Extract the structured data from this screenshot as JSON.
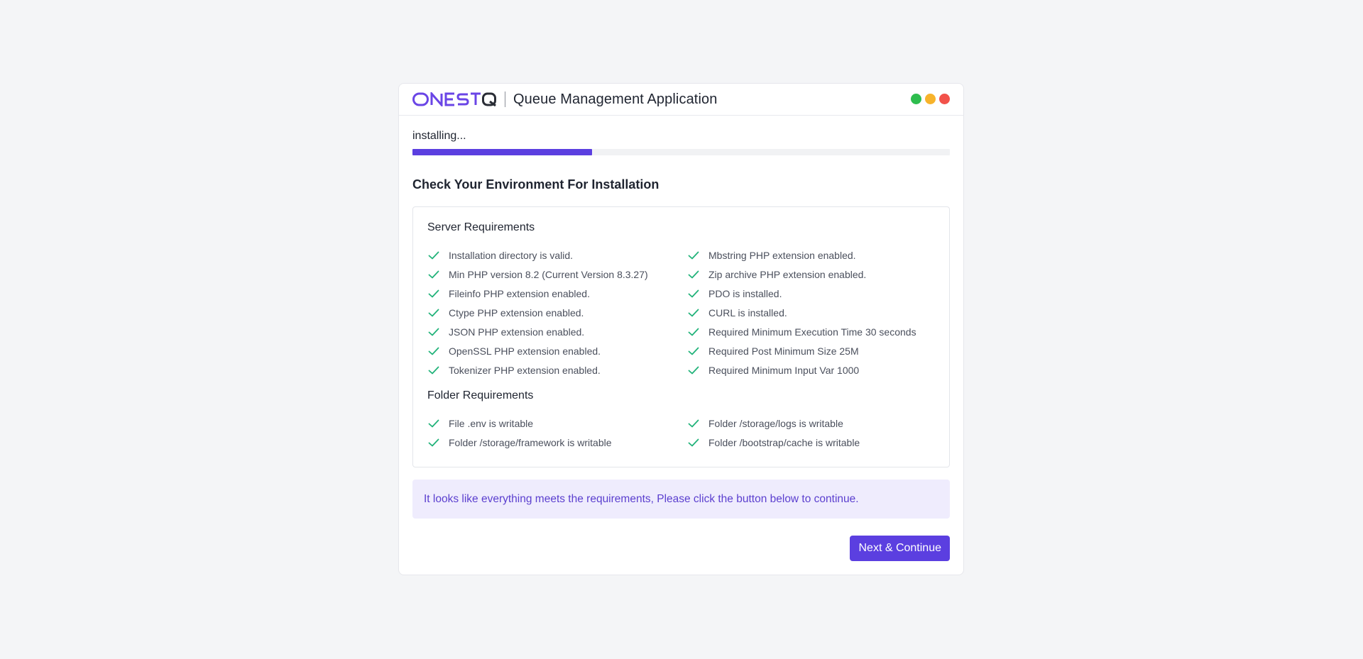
{
  "header": {
    "logo_text": "ONESTQ",
    "app_title": "Queue Management Application",
    "window_dots": [
      "#2ebd4e",
      "#f7b32b",
      "#f2524a"
    ]
  },
  "progress": {
    "status": "installing...",
    "percent": 33.4,
    "color": "#5b3fe0"
  },
  "main": {
    "title": "Check Your Environment For Installation",
    "server": {
      "title": "Server Requirements",
      "items": [
        "Installation directory is valid.",
        "Mbstring PHP extension enabled.",
        "Min PHP version 8.2 (Current Version 8.3.27)",
        "Zip archive PHP extension enabled.",
        "Fileinfo PHP extension enabled.",
        "PDO is installed.",
        "Ctype PHP extension enabled.",
        "CURL is installed.",
        "JSON PHP extension enabled.",
        "Required Minimum Execution Time 30 seconds",
        "OpenSSL PHP extension enabled.",
        "Required Post Minimum Size 25M",
        "Tokenizer PHP extension enabled.",
        "Required Minimum Input Var 1000"
      ]
    },
    "folder": {
      "title": "Folder Requirements",
      "items": [
        "File .env is writable",
        "Folder /storage/logs is writable",
        "Folder /storage/framework is writable",
        "Folder /bootstrap/cache is writable"
      ]
    },
    "notice": "It looks like everything meets the requirements, Please click the button below to continue.",
    "next_button": "Next & Continue"
  },
  "colors": {
    "accent": "#5b3fe0",
    "check": "#22b37a",
    "notice_bg": "#efecfd"
  },
  "icons": {
    "check": "check-icon"
  }
}
